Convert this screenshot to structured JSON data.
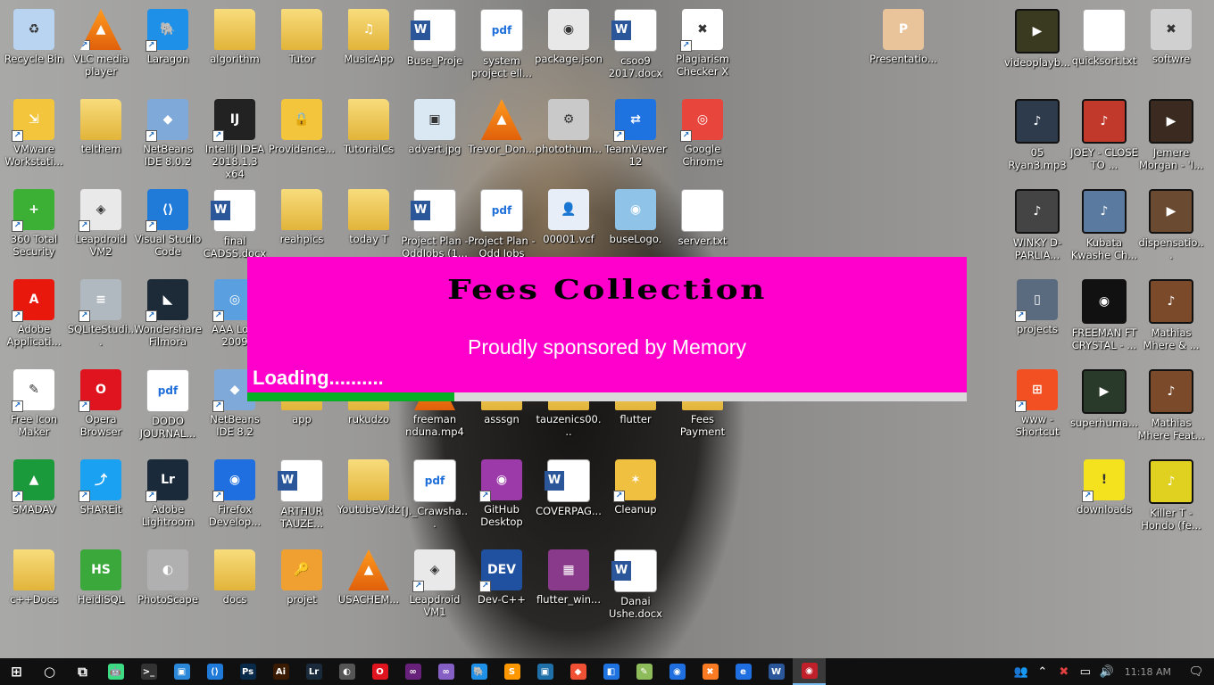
{
  "desktop": {
    "icons": [
      {
        "label": "Recycle Bin",
        "type": "app",
        "color": "#b9d4f0",
        "glyph": "♻",
        "shortcut": false
      },
      {
        "label": "VLC media player",
        "type": "vlc",
        "color": "#f08a1e",
        "glyph": "▲",
        "shortcut": true
      },
      {
        "label": "Laragon",
        "type": "app",
        "color": "#1e90e8",
        "glyph": "🐘",
        "shortcut": true
      },
      {
        "label": "algorithm",
        "type": "folder",
        "color": "#f2cf5b",
        "glyph": "",
        "shortcut": false
      },
      {
        "label": "Tutor",
        "type": "folder",
        "color": "#f2cf5b",
        "glyph": "",
        "shortcut": false
      },
      {
        "label": "MusicApp",
        "type": "folder",
        "color": "#f2cf5b",
        "glyph": "♫",
        "shortcut": false
      },
      {
        "label": "Buse_Proje",
        "type": "word",
        "color": "#2b579a",
        "glyph": "",
        "shortcut": false
      },
      {
        "label": "system project ell...",
        "type": "pdf",
        "color": "#1e6fd9",
        "glyph": "pdf",
        "shortcut": false
      },
      {
        "label": "package.json",
        "type": "app",
        "color": "#e8e8e8",
        "glyph": "◉",
        "shortcut": false
      },
      {
        "label": "csoo9 2017.docx",
        "type": "word",
        "color": "#2b579a",
        "glyph": "",
        "shortcut": false
      },
      {
        "label": "Plagiarism Checker X",
        "type": "app",
        "color": "#ffffff",
        "glyph": "✖",
        "shortcut": true
      },
      {
        "label": "Presentatio...",
        "type": "app",
        "color": "#e9c39a",
        "glyph": "P",
        "shortcut": false
      },
      {
        "label": "videoplayb...",
        "type": "media",
        "color": "#3a3a20",
        "glyph": "▶",
        "shortcut": false
      },
      {
        "label": "quicksort.txt",
        "type": "txt",
        "color": "#ffffff",
        "glyph": "",
        "shortcut": false
      },
      {
        "label": "softwre",
        "type": "app",
        "color": "#d0d0d0",
        "glyph": "✖",
        "shortcut": false
      },
      {
        "label": "VMware Workstati...",
        "type": "app",
        "color": "#f2c53c",
        "glyph": "⇲",
        "shortcut": true
      },
      {
        "label": "telthem",
        "type": "folder",
        "color": "#f2cf5b",
        "glyph": "",
        "shortcut": false
      },
      {
        "label": "NetBeans IDE 8.0.2",
        "type": "app",
        "color": "#7fa9d8",
        "glyph": "◆",
        "shortcut": true
      },
      {
        "label": "IntelliJ IDEA 2018.1.3 x64",
        "type": "app",
        "color": "#222222",
        "glyph": "IJ",
        "shortcut": true
      },
      {
        "label": "Providence...",
        "type": "app",
        "color": "#f2c53c",
        "glyph": "🔒",
        "shortcut": false
      },
      {
        "label": "TutorialCs",
        "type": "folder",
        "color": "#f2cf5b",
        "glyph": "",
        "shortcut": false
      },
      {
        "label": "advert.jpg",
        "type": "app",
        "color": "#d9e8f2",
        "glyph": "▣",
        "shortcut": false
      },
      {
        "label": "Trevor_Don...",
        "type": "vlc",
        "color": "#f08a1e",
        "glyph": "▲",
        "shortcut": false
      },
      {
        "label": "photothum...",
        "type": "app",
        "color": "#c9c9c9",
        "glyph": "⚙",
        "shortcut": false
      },
      {
        "label": "TeamViewer 12",
        "type": "app",
        "color": "#1f73e0",
        "glyph": "⇄",
        "shortcut": true
      },
      {
        "label": "Google Chrome",
        "type": "app",
        "color": "#e8453c",
        "glyph": "◎",
        "shortcut": true
      },
      {
        "label": "05 Ryan3.mp3",
        "type": "media",
        "color": "#2d3b4d",
        "glyph": "♪",
        "shortcut": false
      },
      {
        "label": "JOEY - CLOSE TO ...",
        "type": "media",
        "color": "#c0392b",
        "glyph": "♪",
        "shortcut": false
      },
      {
        "label": "Jemere Morgan - 'I...",
        "type": "media",
        "color": "#3a2a20",
        "glyph": "▶",
        "shortcut": false
      },
      {
        "label": "360 Total Security",
        "type": "app",
        "color": "#3cb034",
        "glyph": "+",
        "shortcut": true
      },
      {
        "label": "Leapdroid VM2",
        "type": "app",
        "color": "#e9e9e9",
        "glyph": "◈",
        "shortcut": true
      },
      {
        "label": "Visual Studio Code",
        "type": "app",
        "color": "#1f7ad8",
        "glyph": "⟨⟩",
        "shortcut": true
      },
      {
        "label": "final CADSS.docx",
        "type": "word",
        "color": "#2b579a",
        "glyph": "",
        "shortcut": false
      },
      {
        "label": "reahpics",
        "type": "folder",
        "color": "#f2cf5b",
        "glyph": "",
        "shortcut": false
      },
      {
        "label": "today T",
        "type": "folder",
        "color": "#f2cf5b",
        "glyph": "",
        "shortcut": false
      },
      {
        "label": "Project Plan - OddJobs (1...",
        "type": "word",
        "color": "#2b579a",
        "glyph": "",
        "shortcut": false
      },
      {
        "label": "Project Plan - Odd Jobs (1...",
        "type": "pdf",
        "color": "#1e6fd9",
        "glyph": "pdf",
        "shortcut": false
      },
      {
        "label": "00001.vcf",
        "type": "app",
        "color": "#e8eef7",
        "glyph": "👤",
        "shortcut": false
      },
      {
        "label": "buseLogo.",
        "type": "app",
        "color": "#8fc3e8",
        "glyph": "◉",
        "shortcut": false
      },
      {
        "label": "server.txt",
        "type": "txt",
        "color": "#ffffff",
        "glyph": "",
        "shortcut": false
      },
      {
        "label": "WINKY D-PARLIA...",
        "type": "media",
        "color": "#444444",
        "glyph": "♪",
        "shortcut": false
      },
      {
        "label": "Kubata Kwashe Ch...",
        "type": "media",
        "color": "#5a7aa0",
        "glyph": "♪",
        "shortcut": false
      },
      {
        "label": "dispensatio...",
        "type": "media",
        "color": "#6a4a30",
        "glyph": "▶",
        "shortcut": false
      },
      {
        "label": "Adobe Applicati...",
        "type": "app",
        "color": "#e8180c",
        "glyph": "A",
        "shortcut": true
      },
      {
        "label": "SQLiteStudi...",
        "type": "app",
        "color": "#b0b8c0",
        "glyph": "≡",
        "shortcut": true
      },
      {
        "label": "Wondershare Filmora",
        "type": "app",
        "color": "#1d2a38",
        "glyph": "◣",
        "shortcut": true
      },
      {
        "label": "AAA Lo... 2009",
        "type": "app",
        "color": "#5aa0e0",
        "glyph": "◎",
        "shortcut": true
      },
      {
        "label": "projects",
        "type": "app",
        "color": "#5a6b80",
        "glyph": "▯",
        "shortcut": true
      },
      {
        "label": "FREEMAN FT CRYSTAL - ...",
        "type": "media",
        "color": "#111111",
        "glyph": "◉",
        "shortcut": false
      },
      {
        "label": "Mathias Mhere & ...",
        "type": "media",
        "color": "#7a4a2a",
        "glyph": "♪",
        "shortcut": false
      },
      {
        "label": "Free Icon Maker",
        "type": "app",
        "color": "#ffffff",
        "glyph": "✎",
        "shortcut": true
      },
      {
        "label": "Opera Browser",
        "type": "app",
        "color": "#e0141e",
        "glyph": "O",
        "shortcut": true
      },
      {
        "label": "DODO JOURNAL...",
        "type": "pdf",
        "color": "#1e6fd9",
        "glyph": "pdf",
        "shortcut": false
      },
      {
        "label": "NetBeans IDE 8.2",
        "type": "app",
        "color": "#7fa9d8",
        "glyph": "◆",
        "shortcut": true
      },
      {
        "label": "app",
        "type": "folder",
        "color": "#f2cf5b",
        "glyph": "",
        "shortcut": false
      },
      {
        "label": "rukudzo",
        "type": "folder",
        "color": "#f2cf5b",
        "glyph": "",
        "shortcut": false
      },
      {
        "label": "freeman nduna.mp4",
        "type": "vlc",
        "color": "#f08a1e",
        "glyph": "▲",
        "shortcut": false
      },
      {
        "label": "asssgn",
        "type": "folder",
        "color": "#f2cf5b",
        "glyph": "",
        "shortcut": false
      },
      {
        "label": "tauzenics00...",
        "type": "folder",
        "color": "#f2cf5b",
        "glyph": "",
        "shortcut": false
      },
      {
        "label": "flutter",
        "type": "folder",
        "color": "#f2cf5b",
        "glyph": "",
        "shortcut": false
      },
      {
        "label": "Fees Payment",
        "type": "folder",
        "color": "#f2cf5b",
        "glyph": "",
        "shortcut": false
      },
      {
        "label": "www - Shortcut",
        "type": "app",
        "color": "#f25022",
        "glyph": "⊞",
        "shortcut": true
      },
      {
        "label": "superhuma...",
        "type": "media",
        "color": "#2a3a2a",
        "glyph": "▶",
        "shortcut": false
      },
      {
        "label": "Mathias Mhere Feat...",
        "type": "media",
        "color": "#7a4a2a",
        "glyph": "♪",
        "shortcut": false
      },
      {
        "label": "SMADAV",
        "type": "app",
        "color": "#1a9a3a",
        "glyph": "▲",
        "shortcut": true
      },
      {
        "label": "SHAREit",
        "type": "app",
        "color": "#1ba1f2",
        "glyph": "⤴",
        "shortcut": true
      },
      {
        "label": "Adobe Lightroom",
        "type": "app",
        "color": "#1a2a3a",
        "glyph": "Lr",
        "shortcut": true
      },
      {
        "label": "Firefox Develop...",
        "type": "app",
        "color": "#1f6fe0",
        "glyph": "◉",
        "shortcut": true
      },
      {
        "label": "ARTHUR TAUZE...",
        "type": "word",
        "color": "#2b579a",
        "glyph": "",
        "shortcut": false
      },
      {
        "label": "YoutubeVidz",
        "type": "folder",
        "color": "#f2cf5b",
        "glyph": "",
        "shortcut": false
      },
      {
        "label": "[J._Crawsha...",
        "type": "pdf",
        "color": "#1e6fd9",
        "glyph": "pdf",
        "shortcut": false
      },
      {
        "label": "GitHub Desktop",
        "type": "app",
        "color": "#9b3aa8",
        "glyph": "◉",
        "shortcut": true
      },
      {
        "label": "COVERPAG...",
        "type": "word",
        "color": "#2b579a",
        "glyph": "",
        "shortcut": false
      },
      {
        "label": "Cleanup",
        "type": "app",
        "color": "#f0c040",
        "glyph": "✶",
        "shortcut": true
      },
      {
        "label": "downloads",
        "type": "app",
        "color": "#f5e21e",
        "glyph": "!",
        "shortcut": true
      },
      {
        "label": "Killer T - Hondo (fe...",
        "type": "media",
        "color": "#e0d020",
        "glyph": "♪",
        "shortcut": false
      },
      {
        "label": "c++Docs",
        "type": "folder",
        "color": "#f2cf5b",
        "glyph": "",
        "shortcut": false
      },
      {
        "label": "HeidiSQL",
        "type": "app",
        "color": "#3aa83a",
        "glyph": "HS",
        "shortcut": false
      },
      {
        "label": "PhotoScape",
        "type": "app",
        "color": "#b0b0b0",
        "glyph": "◐",
        "shortcut": false
      },
      {
        "label": "docs",
        "type": "folder",
        "color": "#f2cf5b",
        "glyph": "",
        "shortcut": false
      },
      {
        "label": "projet",
        "type": "app",
        "color": "#f0a030",
        "glyph": "🔑",
        "shortcut": false
      },
      {
        "label": "USACHEM...",
        "type": "vlc",
        "color": "#f08a1e",
        "glyph": "▲",
        "shortcut": false
      },
      {
        "label": "Leapdroid VM1",
        "type": "app",
        "color": "#e9e9e9",
        "glyph": "◈",
        "shortcut": true
      },
      {
        "label": "Dev-C++",
        "type": "app",
        "color": "#2050a0",
        "glyph": "DEV",
        "shortcut": true
      },
      {
        "label": "flutter_win...",
        "type": "app",
        "color": "#8a3a8a",
        "glyph": "▦",
        "shortcut": false
      },
      {
        "label": "Danai Ushe.docx",
        "type": "word",
        "color": "#2b579a",
        "glyph": "",
        "shortcut": false
      }
    ]
  },
  "splash": {
    "title": "Fees Collection",
    "subtitle": "Proudly sponsored by Memory",
    "loading": "Loading..........",
    "progress_fraction": 0.288,
    "bg_color": "#ff00cc",
    "progress_color": "#06b025"
  },
  "taskbar": {
    "items": [
      {
        "name": "start-button",
        "glyph": "⊞",
        "color": "#101010"
      },
      {
        "name": "cortana-button",
        "glyph": "○",
        "color": "#101010"
      },
      {
        "name": "task-view-button",
        "glyph": "⧉",
        "color": "#101010"
      },
      {
        "name": "android-studio-icon",
        "glyph": "🤖",
        "color": "#3ddc84"
      },
      {
        "name": "command-prompt-icon",
        "glyph": ">_",
        "color": "#333333"
      },
      {
        "name": "control-panel-icon",
        "glyph": "▣",
        "color": "#2b88d8"
      },
      {
        "name": "vscode-icon",
        "glyph": "⟨⟩",
        "color": "#1f7ad8"
      },
      {
        "name": "photoshop-icon",
        "glyph": "Ps",
        "color": "#0a2a4a"
      },
      {
        "name": "illustrator-icon",
        "glyph": "Ai",
        "color": "#3a1a00"
      },
      {
        "name": "lightroom-icon",
        "glyph": "Lr",
        "color": "#1a2a3a"
      },
      {
        "name": "photoscape-icon",
        "glyph": "◐",
        "color": "#555555"
      },
      {
        "name": "opera-icon",
        "glyph": "O",
        "color": "#e0141e"
      },
      {
        "name": "visual-studio-icon",
        "glyph": "∞",
        "color": "#68217a"
      },
      {
        "name": "visual-studio-2-icon",
        "glyph": "∞",
        "color": "#865fc5"
      },
      {
        "name": "laragon-icon",
        "glyph": "🐘",
        "color": "#1e90e8"
      },
      {
        "name": "sublime-icon",
        "glyph": "S",
        "color": "#ff9800"
      },
      {
        "name": "cmd-icon",
        "glyph": "▣",
        "color": "#1f6fa8"
      },
      {
        "name": "git-icon",
        "glyph": "◆",
        "color": "#f05033"
      },
      {
        "name": "teamviewer-icon",
        "glyph": "◧",
        "color": "#1f73e0"
      },
      {
        "name": "notepad-icon",
        "glyph": "✎",
        "color": "#8fbc5a"
      },
      {
        "name": "firefox-icon",
        "glyph": "◉",
        "color": "#1f6fe0"
      },
      {
        "name": "xampp-icon",
        "glyph": "✖",
        "color": "#fb7a24"
      },
      {
        "name": "edge-icon",
        "glyph": "e",
        "color": "#1f6fe0"
      },
      {
        "name": "word-icon",
        "glyph": "W",
        "color": "#2b579a"
      },
      {
        "name": "java-app-icon",
        "glyph": "◉",
        "color": "#c0202a",
        "active": true
      }
    ],
    "clock": "11:18 AM"
  }
}
